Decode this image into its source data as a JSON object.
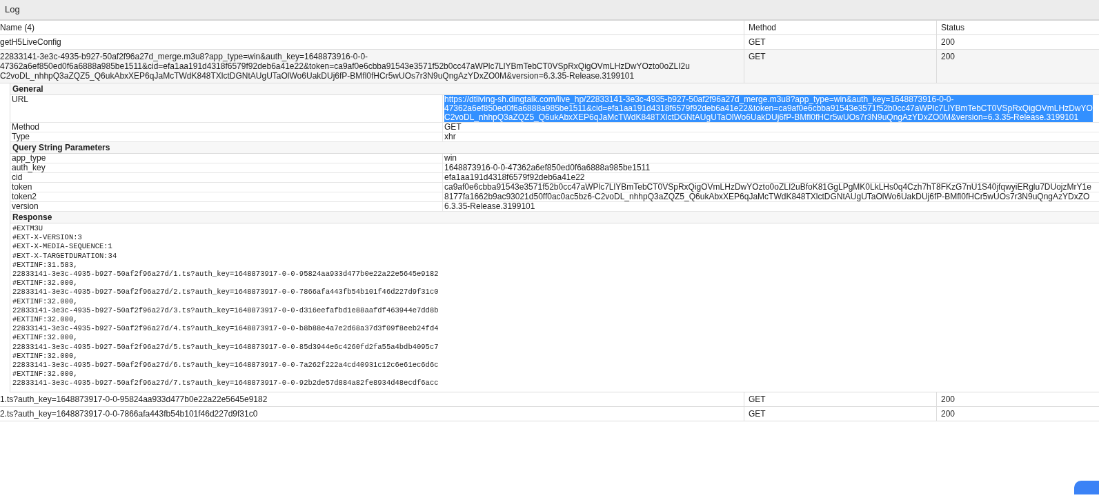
{
  "panel": {
    "title": "Log"
  },
  "table": {
    "columns": [
      "Name (4)",
      "Method",
      "Status"
    ],
    "rows": [
      {
        "name_lines": [
          "getH5LiveConfig"
        ],
        "method": "GET",
        "status": "200"
      },
      {
        "name_lines": [
          "22833141-3e3c-4935-b927-50af2f96a27d_merge.m3u8?app_type=win&auth_key=1648873916-0-0-",
          "47362a6ef850ed0f6a6888a985be1511&cid=efa1aa191d4318f6579f92deb6a41e22&token=ca9af0e6cbba91543e3571f52b0cc47aWPlc7LlYBmTebCT0VSpRxQigOVmLHzDwYOzto0oZLI2u",
          "C2voDL_nhhpQ3aZQZ5_Q6ukAbxXEP6qJaMcTWdK848TXlctDGNtAUgUTaOlWo6UakDUj6fP-BMfl0fHCr5wUOs7r3N9uQngAzYDxZO0M&version=6.3.35-Release.3199101"
        ],
        "method": "GET",
        "status": "200",
        "details": [
          {
            "kind": "fields",
            "title": "General",
            "fields": [
              {
                "label": "URL",
                "value_lines": [
                  "https://dtliving-sh.dingtalk.com/live_hp/22833141-3e3c-4935-b927-50af2f96a27d_merge.m3u8?app_type=win&auth_key=1648873916-0-0-",
                  "47362a6ef850ed0f6a6888a985be1511&cid=efa1aa191d4318f6579f92deb6a41e22&token=ca9af0e6cbba91543e3571f52b0cc47aWPlc7LlYBmTebCT0VSpRxQigOVmLHzDwYO",
                  "C2voDL_nhhpQ3aZQZ5_Q6ukAbxXEP6qJaMcTWdK848TXlctDGNtAUgUTaOlWo6UakDUj6fP-BMfl0fHCr5wUOs7r3N9uQngAzYDxZO0M&version=6.3.35-Release.3199101"
                ],
                "highlighted": true
              },
              {
                "label": "Method",
                "value_lines": [
                  "GET"
                ],
                "highlighted": false
              },
              {
                "label": "Type",
                "value_lines": [
                  "xhr"
                ],
                "highlighted": false
              }
            ]
          },
          {
            "kind": "fields",
            "title": "Query String Parameters",
            "fields": [
              {
                "label": "app_type",
                "value_lines": [
                  "win"
                ],
                "highlighted": false
              },
              {
                "label": "auth_key",
                "value_lines": [
                  "1648873916-0-0-47362a6ef850ed0f6a6888a985be1511"
                ],
                "highlighted": false
              },
              {
                "label": "cid",
                "value_lines": [
                  "efa1aa191d4318f6579f92deb6a41e22"
                ],
                "highlighted": false
              },
              {
                "label": "token",
                "value_lines": [
                  "ca9af0e6cbba91543e3571f52b0cc47aWPlc7LlYBmTebCT0VSpRxQigOVmLHzDwYOzto0oZLI2uBfoK81GgLPgMK0LkLHs0q4Czh7hT8FKzG7nU1S40jfqwyiERglu7DUojzMrY1e"
                ],
                "highlighted": false
              },
              {
                "label": "token2",
                "value_lines": [
                  "8177fa1662b9ac93021d50ff0ac0ac5bz6-C2voDL_nhhpQ3aZQZ5_Q6ukAbxXEP6qJaMcTWdK848TXlctDGNtAUgUTaOlWo6UakDUj6fP-BMfl0fHCr5wUOs7r3N9uQngAzYDxZO"
                ],
                "highlighted": false
              },
              {
                "label": "version",
                "value_lines": [
                  "6.3.35-Release.3199101"
                ],
                "highlighted": false
              }
            ]
          },
          {
            "kind": "code",
            "title": "Response",
            "lines": [
              "#EXTM3U",
              "#EXT-X-VERSION:3",
              "#EXT-X-MEDIA-SEQUENCE:1",
              "#EXT-X-TARGETDURATION:34",
              "#EXTINF:31.583,",
              "22833141-3e3c-4935-b927-50af2f96a27d/1.ts?auth_key=1648873917-0-0-95824aa933d477b0e22a22e5645e9182",
              "#EXTINF:32.000,",
              "22833141-3e3c-4935-b927-50af2f96a27d/2.ts?auth_key=1648873917-0-0-7866afa443fb54b101f46d227d9f31c0",
              "#EXTINF:32.000,",
              "22833141-3e3c-4935-b927-50af2f96a27d/3.ts?auth_key=1648873917-0-0-d316eefafbd1e88aafdf463944e7dd8b",
              "#EXTINF:32.000,",
              "22833141-3e3c-4935-b927-50af2f96a27d/4.ts?auth_key=1648873917-0-0-b8b88e4a7e2d68a37d3f09f8eeb24fd4",
              "#EXTINF:32.000,",
              "22833141-3e3c-4935-b927-50af2f96a27d/5.ts?auth_key=1648873917-0-0-85d3944e6c4260fd2fa55a4bdb4095c7",
              "#EXTINF:32.000,",
              "22833141-3e3c-4935-b927-50af2f96a27d/6.ts?auth_key=1648873917-0-0-7a262f222a4cd40931c12c6e61ec6d6c",
              "#EXTINF:32.000,",
              "22833141-3e3c-4935-b927-50af2f96a27d/7.ts?auth_key=1648873917-0-0-92b2de57d884a82fe8934d48ecdf6acc"
            ]
          }
        ]
      },
      {
        "name_lines": [
          "1.ts?auth_key=1648873917-0-0-95824aa933d477b0e22a22e5645e9182"
        ],
        "method": "GET",
        "status": "200"
      },
      {
        "name_lines": [
          "2.ts?auth_key=1648873917-0-0-7866afa443fb54b101f46d227d9f31c0"
        ],
        "method": "GET",
        "status": "200"
      }
    ]
  }
}
